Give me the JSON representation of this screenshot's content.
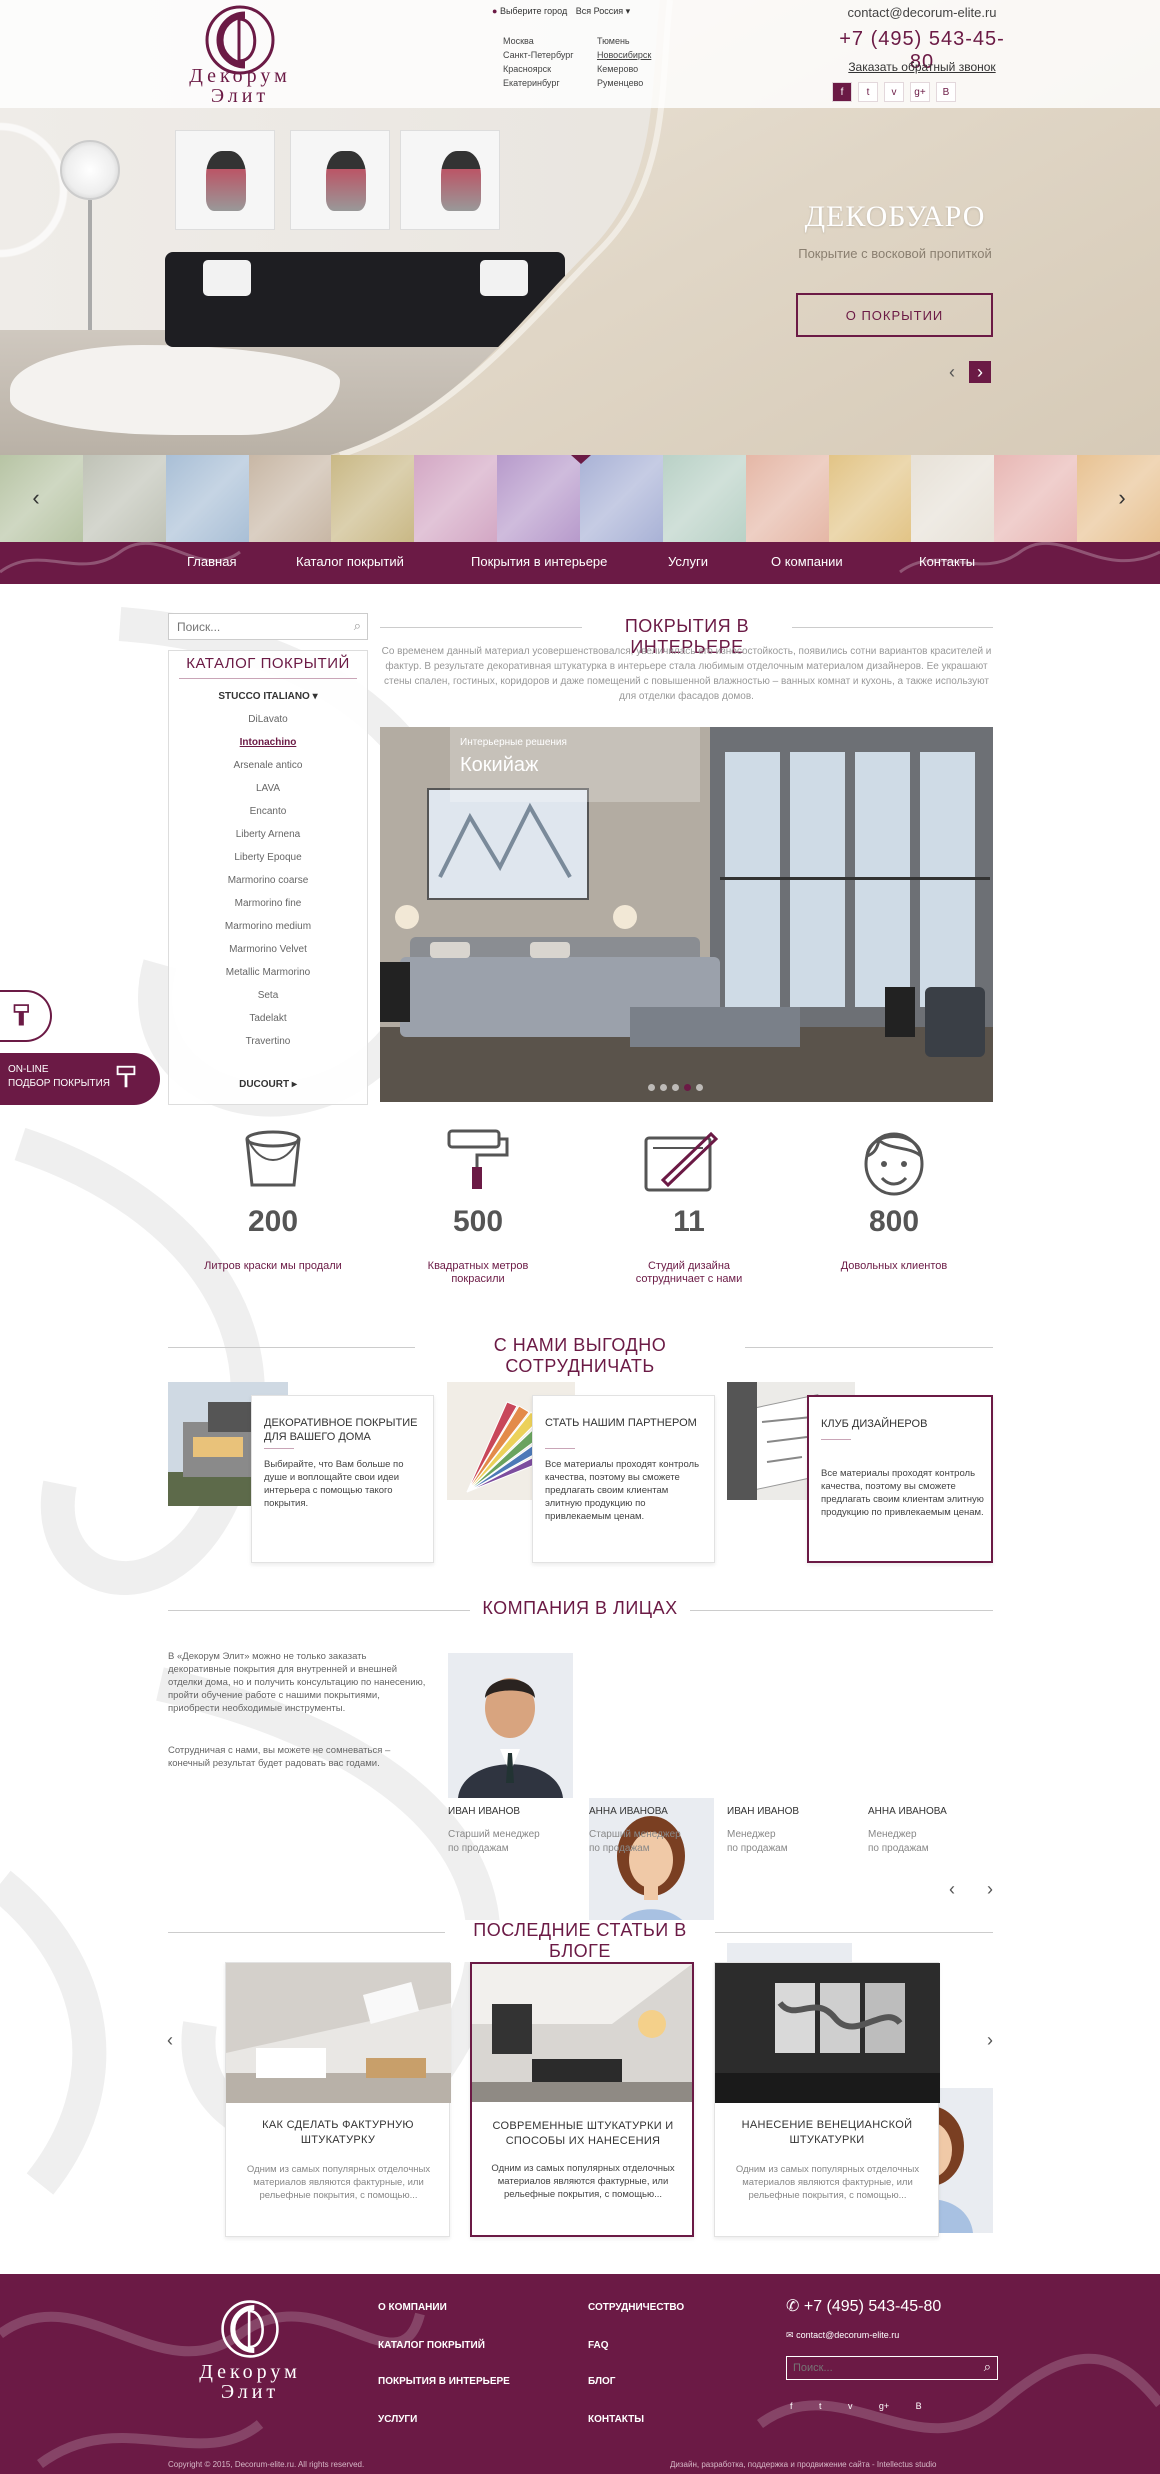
{
  "brand": {
    "name_line1": "Декорум",
    "name_line2": "Элит"
  },
  "header": {
    "city_prompt": "Выберите город",
    "region": "Вся Россия",
    "cities_col1": [
      "Москва",
      "Санкт-Петербург",
      "Красноярск",
      "Екатеринбург"
    ],
    "cities_col2": [
      "Тюмень",
      "Новосибирск",
      "Кемерово",
      "Руменцево"
    ],
    "email": "contact@decorum-elite.ru",
    "phone": "+7 (495) 543-45-80",
    "callback": "Заказать обратный звонок",
    "social": [
      "f",
      "t",
      "v",
      "g+",
      "B"
    ]
  },
  "hero": {
    "title": "ДЕКОБУАРО",
    "subtitle": "Покрытие с восковой пропиткой",
    "button": "О ПОКРЫТИИ",
    "prev": "‹",
    "next": "›"
  },
  "swatches": {
    "colors": [
      "#b7c4a4",
      "#bfc2b6",
      "#a9bfd6",
      "#c8b7a5",
      "#c9b885",
      "#d3a7c4",
      "#b79acb",
      "#a9b2d6",
      "#b9d1c6",
      "#e5b7a6",
      "#e2c486",
      "#e7e1d7",
      "#e8b7b4",
      "#e8c292"
    ],
    "prev": "‹",
    "next": "›"
  },
  "nav": [
    "Главная",
    "Каталог покрытий",
    "Покрытия в интерьере",
    "Услуги",
    "О компании",
    "Контакты"
  ],
  "search": {
    "placeholder": "Поиск..."
  },
  "catalog": {
    "title": "КАТАЛОГ ПОКРЫТИЙ",
    "items": [
      {
        "label": "STUCCO ITALIANO  ▾",
        "kind": "group"
      },
      {
        "label": "DiLavato",
        "kind": "item"
      },
      {
        "label": "Intonachino",
        "kind": "active"
      },
      {
        "label": "Arsenale antico",
        "kind": "item"
      },
      {
        "label": "LAVA",
        "kind": "item"
      },
      {
        "label": "Encanto",
        "kind": "item"
      },
      {
        "label": "Liberty Arnena",
        "kind": "item"
      },
      {
        "label": "Liberty Epoque",
        "kind": "item"
      },
      {
        "label": "Marmorino coarse",
        "kind": "item"
      },
      {
        "label": "Marmorino fine",
        "kind": "item"
      },
      {
        "label": "Marmorino medium",
        "kind": "item"
      },
      {
        "label": "Marmorino Velvet",
        "kind": "item"
      },
      {
        "label": "Metallic Marmorino",
        "kind": "item"
      },
      {
        "label": "Seta",
        "kind": "item"
      },
      {
        "label": "Tadelakt",
        "kind": "item"
      },
      {
        "label": "Travertino",
        "kind": "item"
      },
      {
        "label": "",
        "kind": "spacer"
      },
      {
        "label": "DUCOURT  ▸",
        "kind": "group"
      }
    ]
  },
  "online": {
    "line1": "ON-LINE",
    "line2": "ПОДБОР ПОКРЫТИЯ"
  },
  "interior": {
    "heading": "ПОКРЫТИЯ В ИНТЕРЬЕРЕ",
    "intro": "Со временем данный материал усовершенствовался, увеличилась его износостойкость, появились сотни вариантов красителей и фактур. В результате декоративная штукатурка в интерьере стала любимым отделочным материалом дизайнеров. Ее украшают стены спален, гостиных, коридоров и даже помещений с повышенной влажностью – ванных комнат и кухонь, а также используют для отделки фасадов домов.",
    "caption_small": "Интерьерные решения",
    "caption_big": "Кокийаж",
    "dots": 5
  },
  "stats": [
    {
      "num": "200",
      "label": "Литров краски мы продали",
      "icon": "paint-bucket-icon"
    },
    {
      "num": "500",
      "label": "Квадратных метров покрасили",
      "icon": "paint-roller-icon"
    },
    {
      "num": "11",
      "label": "Студий дизайна сотрудничает с нами",
      "icon": "design-tablet-icon"
    },
    {
      "num": "800",
      "label": "Довольных клиентов",
      "icon": "happy-face-icon"
    }
  ],
  "benefits": {
    "heading": "С НАМИ ВЫГОДНО СОТРУДНИЧАТЬ",
    "cards": [
      {
        "title": "ДЕКОРАТИВНОЕ ПОКРЫТИЕ ДЛЯ ВАШЕГО ДОМА",
        "text": "Выбирайте, что Вам больше по душе и воплощайте свои идеи интерьера с помощью такого покрытия."
      },
      {
        "title": "СТАТЬ НАШИМ ПАРТНЕРОМ",
        "text": "Все материалы проходят контроль качества, поэтому вы сможете предлагать своим клиентам элитную продукцию по привлекаемым ценам."
      },
      {
        "title": "КЛУБ ДИЗАЙНЕРОВ",
        "text": "Все материалы проходят контроль качества, поэтому вы сможете предлагать своим клиентам элитную продукцию по привлекаемым ценам."
      }
    ]
  },
  "team": {
    "heading": "КОМПАНИЯ В ЛИЦАХ",
    "intro1": "В «Декорум Элит» можно не только заказать декоративные покрытия для внутренней и внешней отделки дома, но и получить консультацию по нанесению, пройти обучение работе с нашими покрытиями, приобрести необходимые инструменты.",
    "intro2": "Сотрудничая с нами, вы можете не сомневаться – конечный результат будет радовать вас годами.",
    "people": [
      {
        "name": "ИВАН ИВАНОВ",
        "role1": "Старший менеджер",
        "role2": "по продажам"
      },
      {
        "name": "АННА ИВАНОВА",
        "role1": "Старший менеджер",
        "role2": "по продажам"
      },
      {
        "name": "ИВАН ИВАНОВ",
        "role1": "Менеджер",
        "role2": "по продажам"
      },
      {
        "name": "АННА ИВАНОВА",
        "role1": "Менеджер",
        "role2": "по продажам"
      }
    ],
    "prev": "‹",
    "next": "›"
  },
  "blog": {
    "heading": "ПОСЛЕДНИЕ СТАТЬИ В БЛОГЕ",
    "posts": [
      {
        "title": "КАК СДЕЛАТЬ ФАКТУРНУЮ ШТУКАТУРКУ",
        "text": "Одним из самых популярных отделочных материалов являются фактурные, или рельефные покрытия, с помощью..."
      },
      {
        "title": "СОВРЕМЕННЫЕ ШТУКАТУРКИ И СПОСОБЫ ИХ НАНЕСЕНИЯ",
        "text": "Одним из самых популярных отделочных материалов являются фактурные, или рельефные покрытия, с помощью..."
      },
      {
        "title": "НАНЕСЕНИЕ ВЕНЕЦИАНСКОЙ ШТУКАТУРКИ",
        "text": "Одним из самых популярных отделочных материалов являются фактурные, или рельефные покрытия, с помощью..."
      }
    ],
    "prev": "‹",
    "next": "›"
  },
  "footer": {
    "col1": [
      "О КОМПАНИИ",
      "КАТАЛОГ ПОКРЫТИЙ",
      "ПОКРЫТИЯ В ИНТЕРЬЕРЕ",
      "УСЛУГИ"
    ],
    "col2": [
      "СОТРУДНИЧЕСТВО",
      "FAQ",
      "БЛОГ",
      "КОНТАКТЫ"
    ],
    "phone": "+7 (495) 543-45-80",
    "email": "contact@decorum-elite.ru",
    "search_placeholder": "Поиск...",
    "social": [
      "f",
      "t",
      "v",
      "g+",
      "B"
    ],
    "copyright": "Copyright © 2015, Decorum-elite.ru. All rights reserved.",
    "credits": "Дизайн, разработка, поддержка и продвижение сайта - Intellectus studio"
  },
  "colors": {
    "brand": "#6b1a45"
  }
}
